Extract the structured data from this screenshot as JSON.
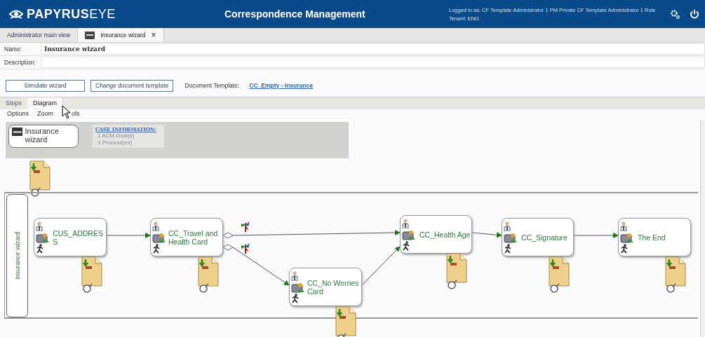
{
  "header": {
    "logo": "**PAPYRUS**EYE",
    "title": "Correspondence Management",
    "login": "Logged in as:  CF Template Administrator 1   PM Private CF Template Administrator 1 Role",
    "tenant": "Tenant: ENG"
  },
  "tabs": [
    {
      "label": "Administrator main view",
      "selected": false
    },
    {
      "label": "Insurance wizard",
      "selected": true,
      "close": "×"
    }
  ],
  "form": {
    "name_label": "Name:",
    "name_value": "Insurance wizard",
    "description_label": "Description:"
  },
  "actions": [
    "Simulate wizard",
    "Change document template"
  ],
  "template": {
    "label": "Document Template:",
    "value": "CC_Empty - Insurance"
  },
  "view_tabs": [
    {
      "label": "Steps",
      "selected": false
    },
    {
      "label": "Diagram",
      "selected": true
    }
  ],
  "menu": [
    "Options",
    "Zoom",
    "ols"
  ],
  "diagram": {
    "root": "Insurance wizard",
    "case_info": {
      "title": "CASE INFORMATION:",
      "lines": [
        "1  ACM Goal(s)",
        "1  Process(es)"
      ]
    },
    "lane": "Insurance wizard",
    "steps": [
      {
        "label": "CUS_ADDRESS"
      },
      {
        "label": "CC_Travel and Health Card"
      },
      {
        "label": "CC_No Worries Card"
      },
      {
        "label": "CC_Health Age"
      },
      {
        "label": "CC_Signature"
      },
      {
        "label": "The End"
      }
    ]
  }
}
